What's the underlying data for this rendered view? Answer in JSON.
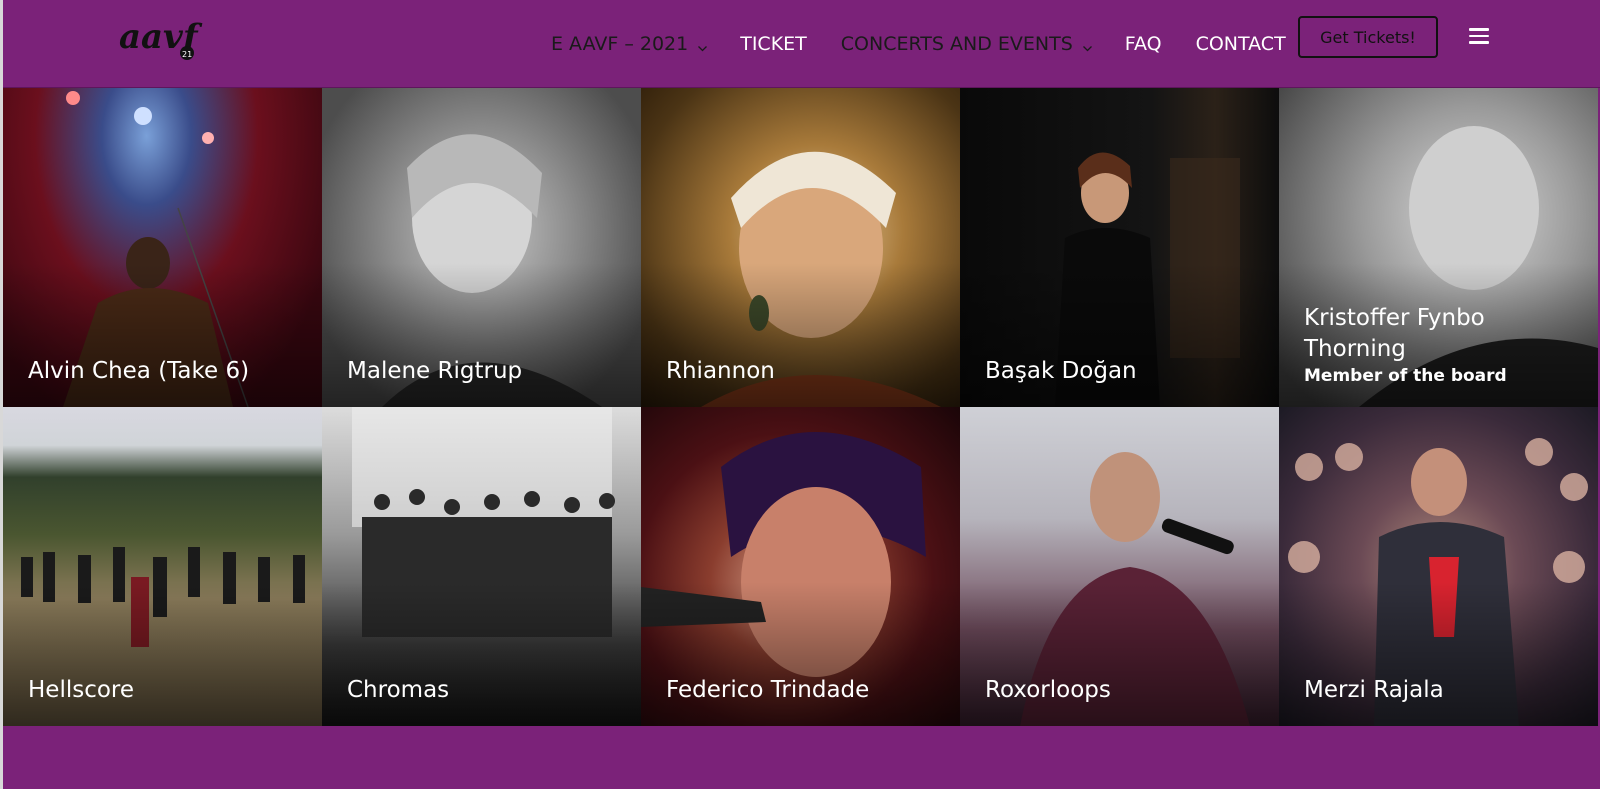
{
  "header": {
    "logo_text": "aavf",
    "logo_badge": "21",
    "nav": [
      {
        "label": "E AAVF – 2021",
        "dropdown": true
      },
      {
        "label": "TICKET",
        "dropdown": false
      },
      {
        "label": "CONCERTS AND EVENTS",
        "dropdown": true
      },
      {
        "label": "FAQ",
        "dropdown": false
      },
      {
        "label": "CONTACT",
        "dropdown": false
      }
    ],
    "cta_label": "Get Tickets!",
    "menu_icon": "hamburger-icon"
  },
  "artists": [
    {
      "name": "Alvin Chea (Take 6)",
      "role": ""
    },
    {
      "name": "Malene Rigtrup",
      "role": ""
    },
    {
      "name": "Rhiannon",
      "role": ""
    },
    {
      "name": "Başak Doğan",
      "role": ""
    },
    {
      "name": "Kristoffer Fynbo Thorning",
      "role": "Member of the board"
    },
    {
      "name": "Hellscore",
      "role": ""
    },
    {
      "name": "Chromas",
      "role": ""
    },
    {
      "name": "Federico Trindade",
      "role": ""
    },
    {
      "name": "Roxorloops",
      "role": ""
    },
    {
      "name": "Merzi Rajala",
      "role": ""
    }
  ],
  "colors": {
    "brand_purple": "#7b2279",
    "text_white": "#ffffff",
    "cta_border": "#111111"
  }
}
